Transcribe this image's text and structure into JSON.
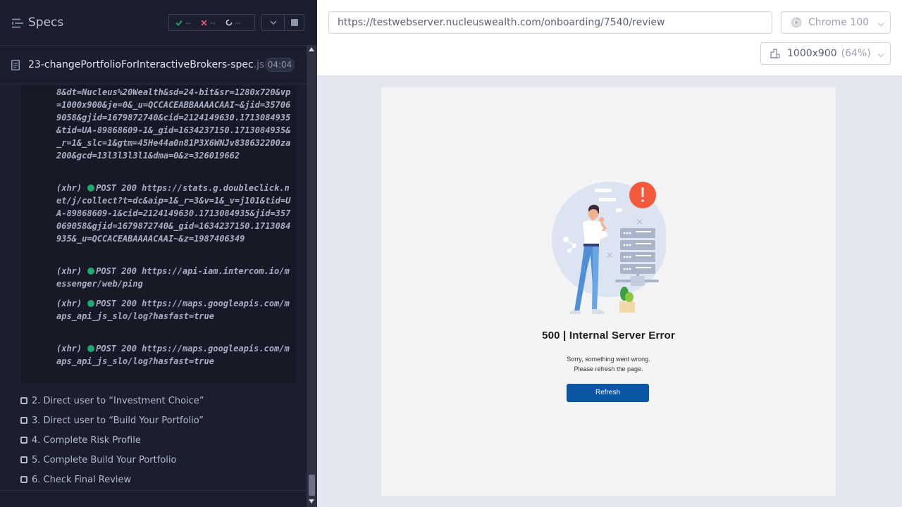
{
  "reporter": {
    "title": "Specs",
    "stats": {
      "passed": "--",
      "failed": "--",
      "pending": "--"
    },
    "spec_file": {
      "name": "23-changePortfolioForInteractiveBrokers-spec",
      "ext": ".js",
      "duration": "04:04"
    },
    "log_entries": [
      {
        "text": "8&dt=Nucleus%20Wealth&sd=24-bit&sr=1280x720&vp=1000x900&je=0&_u=QCCACEABBAAAACAAI~&jid=357069058&gjid=1679872740&cid=2124149630.1713084935&tid=UA-89868609-1&_gid=1634237150.1713084935&_r=1&_slc=1&gtm=45He44a0n81P3X6WNJv838632200za200&gcd=13l3l3l3l1&dma=0&z=326019662"
      },
      {
        "tag": "(xhr)",
        "method": "POST 200",
        "text": "https://stats.g.doubleclick.net/j/collect?t=dc&aip=1&_r=3&v=1&_v=j101&tid=UA-89868609-1&cid=2124149630.1713084935&jid=357069058&gjid=1679872740&_gid=1634237150.1713084935&_u=QCCACEABAAAACAAI~&z=1987406349"
      },
      {
        "tag": "(xhr)",
        "method": "POST 200",
        "text": "https://api-iam.intercom.io/messenger/web/ping"
      },
      {
        "tag": "(xhr)",
        "method": "POST 200",
        "text": "https://maps.googleapis.com/maps_api_js_slo/log?hasfast=true"
      },
      {
        "tag": "(xhr)",
        "method": "POST 200",
        "text": "https://maps.googleapis.com/maps_api_js_slo/log?hasfast=true"
      }
    ],
    "steps": [
      {
        "label": "2. Direct user to “Investment Choice”"
      },
      {
        "label": "3. Direct user to “Build Your Portfolio”"
      },
      {
        "label": "4. Complete Risk Profile"
      },
      {
        "label": "5. Complete Build Your Portfolio"
      },
      {
        "label": "6. Check Final Review"
      }
    ]
  },
  "aut": {
    "url": "https://testwebserver.nucleuswealth.com/onboarding/7540/review",
    "browser": "Chrome 100",
    "viewport": "1000x900",
    "scale": "(64%)",
    "page": {
      "error_title": "500 | Internal Server Error",
      "error_line1": "Sorry, something went wrong.",
      "error_line2": "Please refresh the page.",
      "refresh_label": "Refresh"
    }
  },
  "colors": {
    "passed": "#1fa971",
    "failed": "#e45770",
    "refresh_button": "#0a56a5",
    "alert": "#f4593b"
  }
}
